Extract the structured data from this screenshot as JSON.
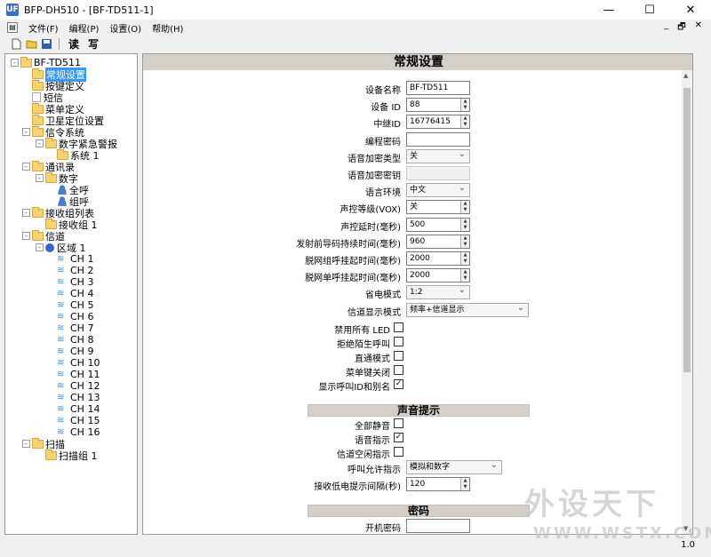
{
  "window": {
    "title": "BFP-DH510 - [BF-TD511-1]",
    "app_icon": "UF",
    "min": "—",
    "max": "☐",
    "close": "✕"
  },
  "menu": {
    "items": [
      "文件(F)",
      "编程(P)",
      "设置(O)",
      "帮助(H)"
    ],
    "mdi": [
      "_",
      "🗗",
      "✕"
    ]
  },
  "toolbar": {
    "read": "读",
    "write": "写"
  },
  "tree": [
    {
      "label": "BF-TD511",
      "icon": "folder",
      "level": 0,
      "exp": "-"
    },
    {
      "label": "常规设置",
      "icon": "folder",
      "level": 1,
      "selected": true
    },
    {
      "label": "按键定义",
      "icon": "folder",
      "level": 1
    },
    {
      "label": "短信",
      "icon": "doc",
      "level": 1
    },
    {
      "label": "菜单定义",
      "icon": "folder",
      "level": 1
    },
    {
      "label": "卫星定位设置",
      "icon": "folder",
      "level": 1
    },
    {
      "label": "信令系统",
      "icon": "folder",
      "level": 1,
      "exp": "-"
    },
    {
      "label": "数字紧急警报",
      "icon": "folder",
      "level": 2,
      "exp": "-"
    },
    {
      "label": "系统 1",
      "icon": "folder",
      "level": 3
    },
    {
      "label": "通讯录",
      "icon": "folder",
      "level": 1,
      "exp": "-"
    },
    {
      "label": "数字",
      "icon": "folder",
      "level": 2,
      "exp": "-"
    },
    {
      "label": "全呼",
      "icon": "person",
      "level": 3
    },
    {
      "label": "组呼",
      "icon": "person",
      "level": 3
    },
    {
      "label": "接收组列表",
      "icon": "folder",
      "level": 1,
      "exp": "-"
    },
    {
      "label": "接收组 1",
      "icon": "folder",
      "level": 2
    },
    {
      "label": "信道",
      "icon": "folder",
      "level": 1,
      "exp": "-"
    },
    {
      "label": "区域 1",
      "icon": "globe",
      "level": 2,
      "exp": "-"
    },
    {
      "label": "CH 1",
      "icon": "wifi",
      "level": 3
    },
    {
      "label": "CH 2",
      "icon": "wifi",
      "level": 3
    },
    {
      "label": "CH 3",
      "icon": "wifi",
      "level": 3
    },
    {
      "label": "CH 4",
      "icon": "wifi",
      "level": 3
    },
    {
      "label": "CH 5",
      "icon": "wifi",
      "level": 3
    },
    {
      "label": "CH 6",
      "icon": "wifi",
      "level": 3
    },
    {
      "label": "CH 7",
      "icon": "wifi",
      "level": 3
    },
    {
      "label": "CH 8",
      "icon": "wifi",
      "level": 3
    },
    {
      "label": "CH 9",
      "icon": "wifi",
      "level": 3
    },
    {
      "label": "CH 10",
      "icon": "wifi",
      "level": 3
    },
    {
      "label": "CH 11",
      "icon": "wifi",
      "level": 3
    },
    {
      "label": "CH 12",
      "icon": "wifi",
      "level": 3
    },
    {
      "label": "CH 13",
      "icon": "wifi",
      "level": 3
    },
    {
      "label": "CH 14",
      "icon": "wifi",
      "level": 3
    },
    {
      "label": "CH 15",
      "icon": "wifi",
      "level": 3
    },
    {
      "label": "CH 16",
      "icon": "wifi",
      "level": 3
    },
    {
      "label": "扫描",
      "icon": "folder",
      "level": 1,
      "exp": "-"
    },
    {
      "label": "扫描组 1",
      "icon": "folder",
      "level": 2
    }
  ],
  "content": {
    "header": "常规设置",
    "sections": {
      "sound": "声音提示",
      "password": "密码"
    },
    "fields": [
      {
        "label": "设备名称",
        "type": "text",
        "value": "BF-TD511",
        "width": 72
      },
      {
        "label": "设备 ID",
        "type": "spin",
        "value": "88"
      },
      {
        "label": "中继ID",
        "type": "spin",
        "value": "16776415"
      },
      {
        "label": "编程密码",
        "type": "text",
        "value": "",
        "width": 72
      },
      {
        "label": "语音加密类型",
        "type": "select",
        "value": "关",
        "width": 72
      },
      {
        "label": "语音加密密钥",
        "type": "disabled",
        "value": "",
        "width": 72
      },
      {
        "label": "语言环境",
        "type": "select",
        "value": "中文",
        "width": 72
      },
      {
        "label": "声控等级(VOX)",
        "type": "spin",
        "value": "关"
      },
      {
        "label": "声控延时(毫秒)",
        "type": "spin",
        "value": "500"
      },
      {
        "label": "发射前导码持续时间(毫秒)",
        "type": "spin",
        "value": "960"
      },
      {
        "label": "脱网组呼挂起时间(毫秒)",
        "type": "spin",
        "value": "2000"
      },
      {
        "label": "脱网单呼挂起时间(毫秒)",
        "type": "spin",
        "value": "2000"
      },
      {
        "label": "省电模式",
        "type": "select",
        "value": "1:2",
        "width": 72
      },
      {
        "label": "信道显示模式",
        "type": "select",
        "value": "频率+信道显示",
        "width": 138
      }
    ],
    "checkboxes": [
      {
        "label": "禁用所有 LED",
        "checked": false
      },
      {
        "label": "拒绝陌生呼叫",
        "checked": false
      },
      {
        "label": "直通模式",
        "checked": false
      },
      {
        "label": "菜单键关闭",
        "checked": false
      },
      {
        "label": "显示呼叫ID和别名",
        "checked": true
      }
    ],
    "sound_checkboxes": [
      {
        "label": "全部静音",
        "checked": false
      },
      {
        "label": "语音指示",
        "checked": true
      },
      {
        "label": "信道空闲指示",
        "checked": false
      }
    ],
    "sound_fields": [
      {
        "label": "呼叫允许指示",
        "type": "select",
        "value": "模拟和数字",
        "width": 108
      },
      {
        "label": "接收低电提示间隔(秒)",
        "type": "spin",
        "value": "120"
      }
    ],
    "password_fields": [
      {
        "label": "开机密码",
        "type": "text",
        "value": "",
        "width": 72
      }
    ],
    "check_mark": "✓"
  },
  "status": {
    "version": "1.0"
  },
  "watermark": {
    "main": "外设天下",
    "sub": "WWW.WSTX.COM"
  }
}
